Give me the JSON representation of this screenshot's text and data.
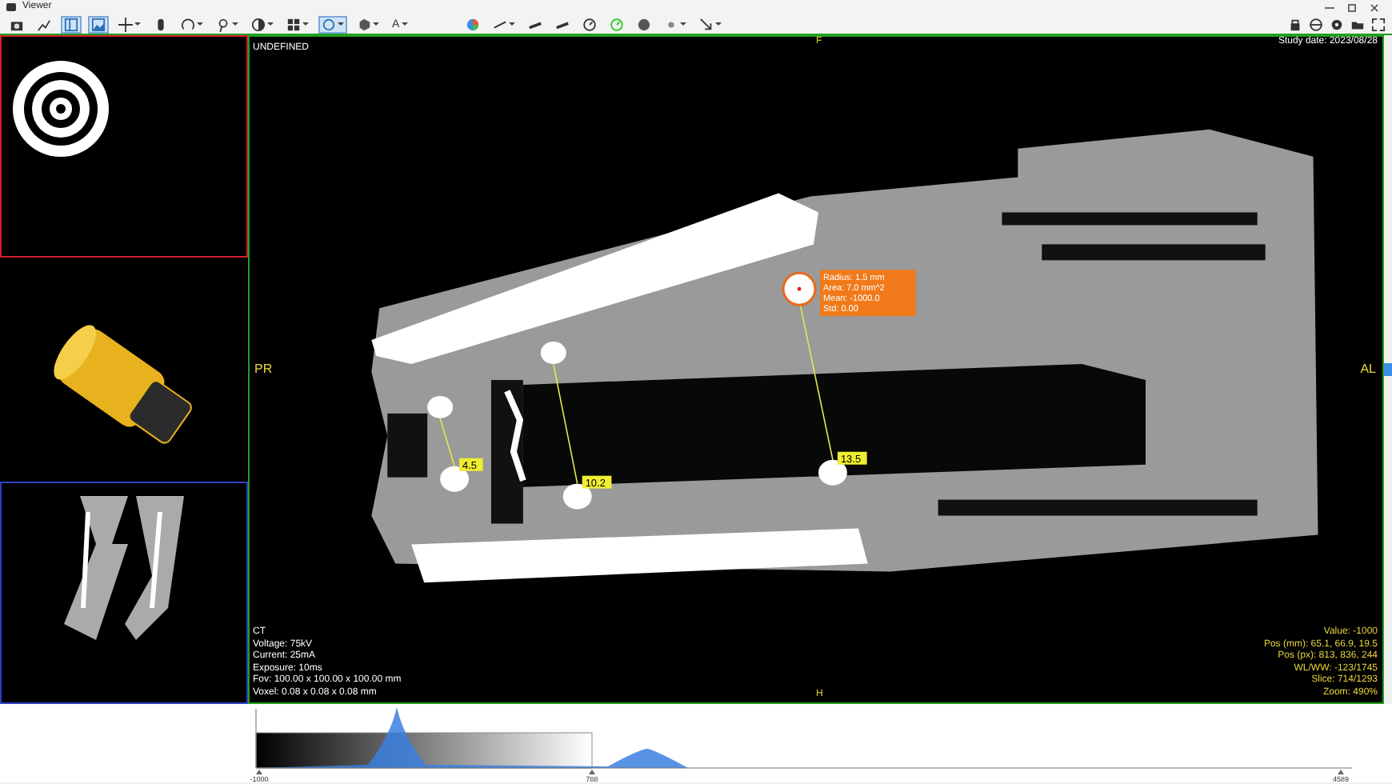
{
  "window": {
    "title": "Viewer"
  },
  "toolbar": {
    "left": [
      {
        "kind": "camera",
        "selected": false,
        "dropdown": false
      },
      {
        "kind": "export",
        "selected": false,
        "dropdown": false
      },
      {
        "kind": "layout",
        "selected": true,
        "dropdown": false
      },
      {
        "kind": "image",
        "selected": true,
        "dropdown": false
      },
      {
        "kind": "crosshair",
        "selected": false,
        "dropdown": true
      },
      {
        "kind": "hand",
        "selected": false,
        "dropdown": false
      },
      {
        "kind": "rotate",
        "selected": false,
        "dropdown": true
      },
      {
        "kind": "probe",
        "selected": false,
        "dropdown": true
      },
      {
        "kind": "contrast",
        "selected": false,
        "dropdown": true
      },
      {
        "kind": "grid",
        "selected": false,
        "dropdown": true
      },
      {
        "kind": "circle",
        "selected": true,
        "dropdown": true
      },
      {
        "kind": "cube",
        "selected": false,
        "dropdown": true
      },
      {
        "kind": "letter",
        "label": "A",
        "selected": false,
        "dropdown": true
      },
      {
        "kind": "gap"
      },
      {
        "kind": "palette",
        "selected": false,
        "dropdown": false
      },
      {
        "kind": "line",
        "selected": false,
        "dropdown": true
      },
      {
        "kind": "bar",
        "selected": false,
        "dropdown": false
      },
      {
        "kind": "bar",
        "selected": false,
        "dropdown": false
      },
      {
        "kind": "dial",
        "selected": false,
        "dropdown": false
      },
      {
        "kind": "dial-green",
        "selected": false,
        "dropdown": false
      },
      {
        "kind": "sphere",
        "selected": false,
        "dropdown": false
      },
      {
        "kind": "dot",
        "selected": false,
        "dropdown": true
      },
      {
        "kind": "arrow",
        "selected": false,
        "dropdown": true
      }
    ],
    "right": [
      {
        "kind": "lock"
      },
      {
        "kind": "wheel"
      },
      {
        "kind": "gear"
      },
      {
        "kind": "folder"
      },
      {
        "kind": "expand"
      }
    ]
  },
  "panels": [
    {
      "kind": "rings",
      "color": "#d0202a"
    },
    {
      "kind": "model"
    },
    {
      "kind": "slice",
      "color": "#3040c0"
    }
  ],
  "viewport": {
    "study_date": "Study date: 2023/08/28",
    "series_label": "UNDEFINED",
    "orientation": {
      "top": "F",
      "left": "PR",
      "right": "AL",
      "bottom": "H"
    },
    "info_left": [
      "CT",
      "Voltage: 75kV",
      "Current: 25mA",
      "Exposure: 10ms",
      "Fov: 100.00 x 100.00 x 100.00 mm",
      "Voxel: 0.08 x 0.08 x 0.08 mm"
    ],
    "info_right": [
      "Value: -1000",
      "Pos (mm): 65.1, 66.9, 19.5",
      "Pos (px): 813, 836, 244",
      "WL/WW: -123/1745",
      "Slice: 714/1293",
      "Zoom: 490%"
    ],
    "measurements": [
      {
        "label": "4.5"
      },
      {
        "label": "10.2"
      },
      {
        "label": "13.5"
      }
    ],
    "roi": {
      "lines": [
        "Radius: 1.5 mm",
        "Area: 7.0 mm^2",
        "Mean: -1000.0",
        "Std: 0.00"
      ]
    }
  },
  "histogram": {
    "tick_labels": [
      "-1000",
      "788",
      "4589"
    ]
  }
}
